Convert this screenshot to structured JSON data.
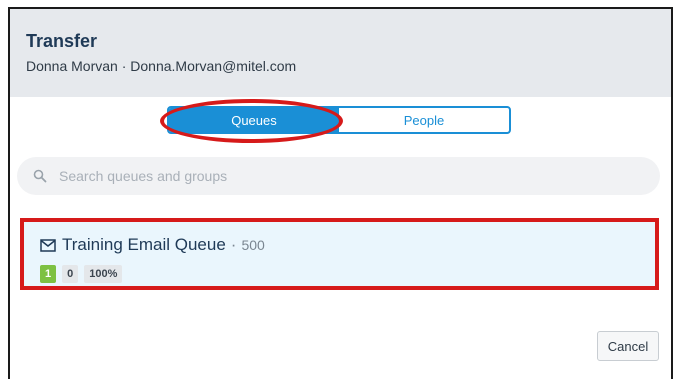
{
  "dialog": {
    "title": "Transfer",
    "subtitle": "Donna Morvan · Donna.Morvan@mitel.com"
  },
  "toggle": {
    "queues_label": "Queues",
    "people_label": "People",
    "selected": "Queues"
  },
  "search": {
    "placeholder": "Search queues and groups",
    "value": ""
  },
  "queues": [
    {
      "name": "Training Email Queue",
      "separator": "·",
      "number": "500",
      "badges": [
        "1",
        "0",
        "100%"
      ],
      "icon": "mail-icon"
    }
  ],
  "footer": {
    "cancel_label": "Cancel"
  },
  "colors": {
    "accent": "#1a8fd6",
    "highlight": "#d61a1a",
    "ready_badge": "#7dc142"
  }
}
